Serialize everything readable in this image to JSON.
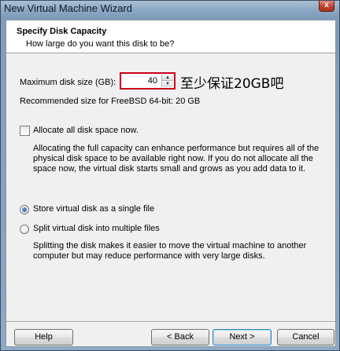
{
  "window": {
    "title": "New Virtual Machine Wizard",
    "close_glyph": "x"
  },
  "header": {
    "title": "Specify Disk Capacity",
    "subtitle": "How large do you want this disk to be?"
  },
  "disk_size": {
    "label": "Maximum disk size (GB):",
    "value": "40",
    "annotation": "至少保证20GB吧",
    "recommended": "Recommended size for FreeBSD 64-bit: 20 GB"
  },
  "allocate": {
    "label": "Allocate all disk space now.",
    "checked": false,
    "description": "Allocating the full capacity can enhance performance but requires all of the physical disk space to be available right now. If you do not allocate all the space now, the virtual disk starts small and grows as you add data to it."
  },
  "storage_options": {
    "single_label": "Store virtual disk as a single file",
    "multiple_label": "Split virtual disk into multiple files",
    "selected": "single",
    "split_description": "Splitting the disk makes it easier to move the virtual machine to another computer but may reduce performance with very large disks."
  },
  "buttons": {
    "help": "Help",
    "back": "< Back",
    "next": "Next >",
    "cancel": "Cancel"
  },
  "icons": {
    "spin_up": "triangle-up",
    "spin_down": "triangle-down"
  },
  "colors": {
    "annotation_highlight": "#c8001a",
    "radio_selected": "#1d4f9c"
  }
}
